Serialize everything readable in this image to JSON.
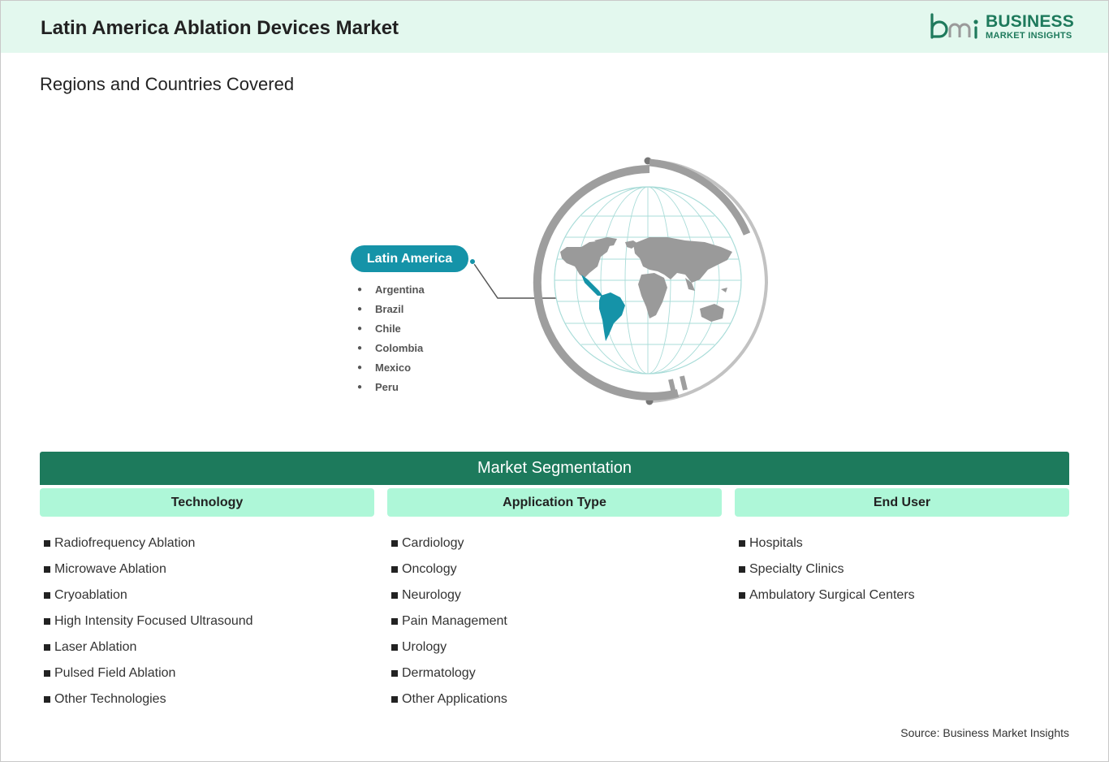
{
  "header": {
    "title": "Latin America Ablation Devices Market",
    "logo": {
      "mark": "bmi",
      "name": "BUSINESS",
      "tagline": "MARKET INSIGHTS",
      "color": "#1e7a5c"
    }
  },
  "section_title": "Regions and Countries Covered",
  "region": {
    "name": "Latin America",
    "color": "#1593a8",
    "countries": [
      "Argentina",
      "Brazil",
      "Chile",
      "Colombia",
      "Mexico",
      "Peru"
    ]
  },
  "segmentation": {
    "title": "Market Segmentation",
    "bar_color": "#1d7a5c",
    "header_color": "#aef7d8",
    "columns": [
      {
        "heading": "Technology",
        "items": [
          "Radiofrequency Ablation",
          "Microwave Ablation",
          "Cryoablation",
          "High Intensity Focused Ultrasound",
          "Laser Ablation",
          "Pulsed Field Ablation",
          "Other Technologies"
        ]
      },
      {
        "heading": "Application Type",
        "items": [
          "Cardiology",
          "Oncology",
          "Neurology",
          "Pain Management",
          "Urology",
          "Dermatology",
          "Other Applications"
        ]
      },
      {
        "heading": "End User",
        "items": [
          "Hospitals",
          "Specialty Clinics",
          "Ambulatory Surgical Centers"
        ]
      }
    ]
  },
  "source": "Source: Business Market Insights"
}
